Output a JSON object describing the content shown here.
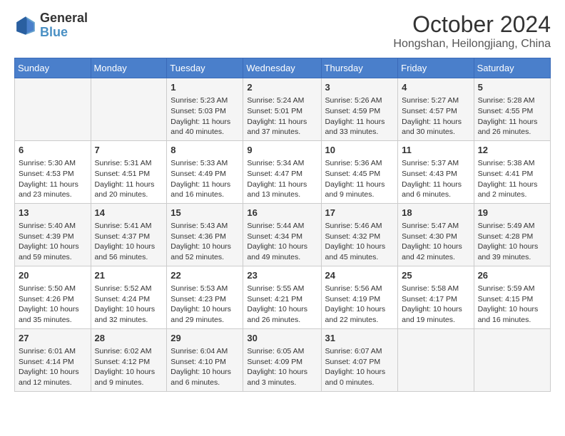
{
  "header": {
    "logo_line1": "General",
    "logo_line2": "Blue",
    "title": "October 2024",
    "subtitle": "Hongshan, Heilongjiang, China"
  },
  "days_of_week": [
    "Sunday",
    "Monday",
    "Tuesday",
    "Wednesday",
    "Thursday",
    "Friday",
    "Saturday"
  ],
  "weeks": [
    [
      {
        "day": "",
        "content": ""
      },
      {
        "day": "",
        "content": ""
      },
      {
        "day": "1",
        "content": "Sunrise: 5:23 AM\nSunset: 5:03 PM\nDaylight: 11 hours and 40 minutes."
      },
      {
        "day": "2",
        "content": "Sunrise: 5:24 AM\nSunset: 5:01 PM\nDaylight: 11 hours and 37 minutes."
      },
      {
        "day": "3",
        "content": "Sunrise: 5:26 AM\nSunset: 4:59 PM\nDaylight: 11 hours and 33 minutes."
      },
      {
        "day": "4",
        "content": "Sunrise: 5:27 AM\nSunset: 4:57 PM\nDaylight: 11 hours and 30 minutes."
      },
      {
        "day": "5",
        "content": "Sunrise: 5:28 AM\nSunset: 4:55 PM\nDaylight: 11 hours and 26 minutes."
      }
    ],
    [
      {
        "day": "6",
        "content": "Sunrise: 5:30 AM\nSunset: 4:53 PM\nDaylight: 11 hours and 23 minutes."
      },
      {
        "day": "7",
        "content": "Sunrise: 5:31 AM\nSunset: 4:51 PM\nDaylight: 11 hours and 20 minutes."
      },
      {
        "day": "8",
        "content": "Sunrise: 5:33 AM\nSunset: 4:49 PM\nDaylight: 11 hours and 16 minutes."
      },
      {
        "day": "9",
        "content": "Sunrise: 5:34 AM\nSunset: 4:47 PM\nDaylight: 11 hours and 13 minutes."
      },
      {
        "day": "10",
        "content": "Sunrise: 5:36 AM\nSunset: 4:45 PM\nDaylight: 11 hours and 9 minutes."
      },
      {
        "day": "11",
        "content": "Sunrise: 5:37 AM\nSunset: 4:43 PM\nDaylight: 11 hours and 6 minutes."
      },
      {
        "day": "12",
        "content": "Sunrise: 5:38 AM\nSunset: 4:41 PM\nDaylight: 11 hours and 2 minutes."
      }
    ],
    [
      {
        "day": "13",
        "content": "Sunrise: 5:40 AM\nSunset: 4:39 PM\nDaylight: 10 hours and 59 minutes."
      },
      {
        "day": "14",
        "content": "Sunrise: 5:41 AM\nSunset: 4:37 PM\nDaylight: 10 hours and 56 minutes."
      },
      {
        "day": "15",
        "content": "Sunrise: 5:43 AM\nSunset: 4:36 PM\nDaylight: 10 hours and 52 minutes."
      },
      {
        "day": "16",
        "content": "Sunrise: 5:44 AM\nSunset: 4:34 PM\nDaylight: 10 hours and 49 minutes."
      },
      {
        "day": "17",
        "content": "Sunrise: 5:46 AM\nSunset: 4:32 PM\nDaylight: 10 hours and 45 minutes."
      },
      {
        "day": "18",
        "content": "Sunrise: 5:47 AM\nSunset: 4:30 PM\nDaylight: 10 hours and 42 minutes."
      },
      {
        "day": "19",
        "content": "Sunrise: 5:49 AM\nSunset: 4:28 PM\nDaylight: 10 hours and 39 minutes."
      }
    ],
    [
      {
        "day": "20",
        "content": "Sunrise: 5:50 AM\nSunset: 4:26 PM\nDaylight: 10 hours and 35 minutes."
      },
      {
        "day": "21",
        "content": "Sunrise: 5:52 AM\nSunset: 4:24 PM\nDaylight: 10 hours and 32 minutes."
      },
      {
        "day": "22",
        "content": "Sunrise: 5:53 AM\nSunset: 4:23 PM\nDaylight: 10 hours and 29 minutes."
      },
      {
        "day": "23",
        "content": "Sunrise: 5:55 AM\nSunset: 4:21 PM\nDaylight: 10 hours and 26 minutes."
      },
      {
        "day": "24",
        "content": "Sunrise: 5:56 AM\nSunset: 4:19 PM\nDaylight: 10 hours and 22 minutes."
      },
      {
        "day": "25",
        "content": "Sunrise: 5:58 AM\nSunset: 4:17 PM\nDaylight: 10 hours and 19 minutes."
      },
      {
        "day": "26",
        "content": "Sunrise: 5:59 AM\nSunset: 4:15 PM\nDaylight: 10 hours and 16 minutes."
      }
    ],
    [
      {
        "day": "27",
        "content": "Sunrise: 6:01 AM\nSunset: 4:14 PM\nDaylight: 10 hours and 12 minutes."
      },
      {
        "day": "28",
        "content": "Sunrise: 6:02 AM\nSunset: 4:12 PM\nDaylight: 10 hours and 9 minutes."
      },
      {
        "day": "29",
        "content": "Sunrise: 6:04 AM\nSunset: 4:10 PM\nDaylight: 10 hours and 6 minutes."
      },
      {
        "day": "30",
        "content": "Sunrise: 6:05 AM\nSunset: 4:09 PM\nDaylight: 10 hours and 3 minutes."
      },
      {
        "day": "31",
        "content": "Sunrise: 6:07 AM\nSunset: 4:07 PM\nDaylight: 10 hours and 0 minutes."
      },
      {
        "day": "",
        "content": ""
      },
      {
        "day": "",
        "content": ""
      }
    ]
  ]
}
